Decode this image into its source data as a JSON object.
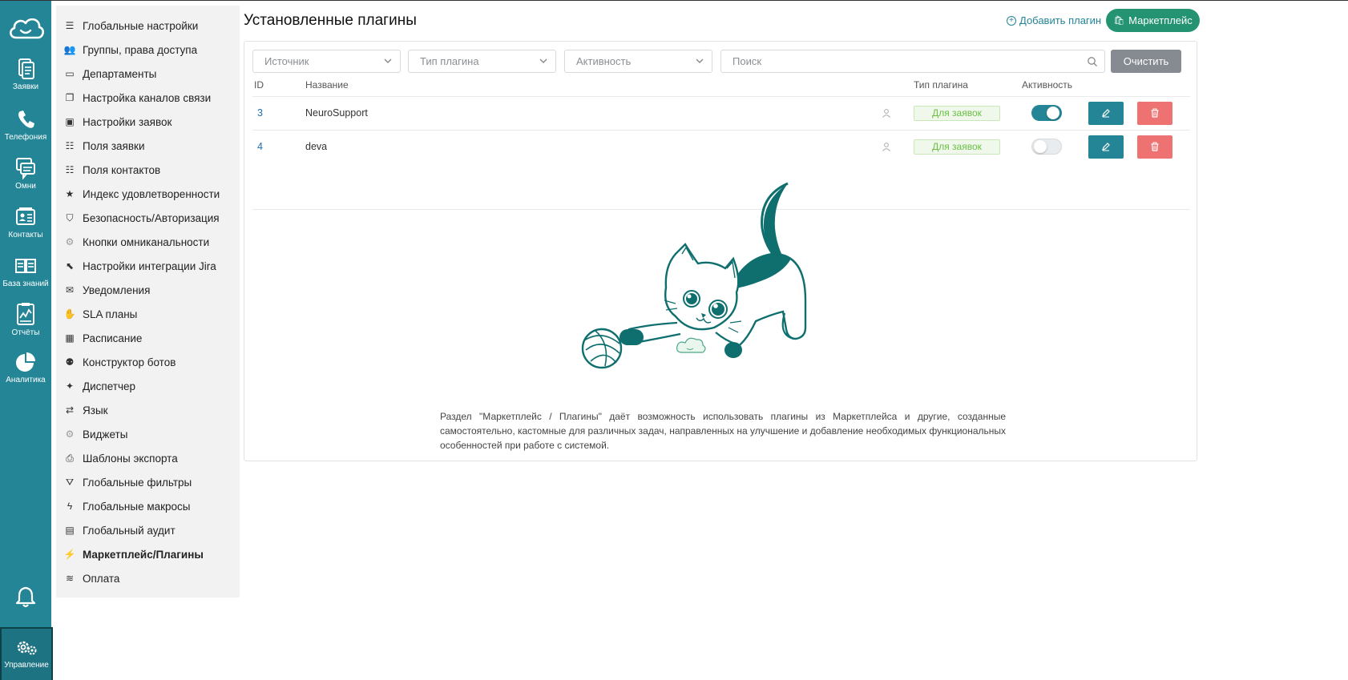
{
  "rail": {
    "items": [
      {
        "label": "Заявки",
        "icon": "requests-icon"
      },
      {
        "label": "Телефония",
        "icon": "phone-icon"
      },
      {
        "label": "Омни",
        "icon": "omni-chat-icon"
      },
      {
        "label": "Контакты",
        "icon": "contacts-icon"
      },
      {
        "label": "База знаний",
        "icon": "knowledge-base-icon"
      },
      {
        "label": "Отчёты",
        "icon": "reports-icon"
      },
      {
        "label": "Аналитика",
        "icon": "analytics-pie-icon"
      }
    ],
    "manage": {
      "label": "Управление",
      "icon": "gears-icon"
    }
  },
  "menu": {
    "items": [
      {
        "label": "Глобальные настройки",
        "icon": "sliders-icon"
      },
      {
        "label": "Группы, права доступа",
        "icon": "users-icon"
      },
      {
        "label": "Департаменты",
        "icon": "inbox-icon"
      },
      {
        "label": "Настройка каналов связи",
        "icon": "documents-icon"
      },
      {
        "label": "Настройки заявок",
        "icon": "image-icon"
      },
      {
        "label": "Поля заявки",
        "icon": "form-icon"
      },
      {
        "label": "Поля контактов",
        "icon": "form-edit-icon"
      },
      {
        "label": "Индекс удовлетворенности",
        "icon": "star-icon"
      },
      {
        "label": "Безопасность/Авторизация",
        "icon": "shield-icon"
      },
      {
        "label": "Кнопки омниканальности",
        "icon": "cog-icon"
      },
      {
        "label": "Настройки интеграции Jira",
        "icon": "jira-icon"
      },
      {
        "label": "Уведомления",
        "icon": "envelope-icon"
      },
      {
        "label": "SLA планы",
        "icon": "handshake-icon"
      },
      {
        "label": "Расписание",
        "icon": "calendar-icon"
      },
      {
        "label": "Конструктор ботов",
        "icon": "bot-icon"
      },
      {
        "label": "Диспетчер",
        "icon": "magic-wand-icon"
      },
      {
        "label": "Язык",
        "icon": "language-icon"
      },
      {
        "label": "Виджеты",
        "icon": "cog-icon"
      },
      {
        "label": "Шаблоны экспорта",
        "icon": "printer-icon"
      },
      {
        "label": "Глобальные фильтры",
        "icon": "filter-icon"
      },
      {
        "label": "Глобальные макросы",
        "icon": "bolt-icon"
      },
      {
        "label": "Глобальный аудит",
        "icon": "audit-icon"
      },
      {
        "label": "Маркетплейс/Плагины",
        "icon": "plug-icon",
        "active": true
      },
      {
        "label": "Оплата",
        "icon": "money-icon"
      }
    ]
  },
  "header": {
    "title": "Установленные плагины",
    "add_plugin": "Добавить плагин",
    "marketplace": "Маркетплейс"
  },
  "filters": {
    "source": "Источник",
    "plugin_type": "Тип плагина",
    "activity": "Активность",
    "search_placeholder": "Поиск",
    "clear": "Очистить"
  },
  "table": {
    "columns": [
      "ID",
      "Название",
      "Тип плагина",
      "Активность"
    ],
    "rows": [
      {
        "id": "3",
        "name": "NeuroSupport",
        "type": "Для заявок",
        "active": true
      },
      {
        "id": "4",
        "name": "deva",
        "type": "Для заявок",
        "active": false
      }
    ]
  },
  "description": "Раздел \"Маркетплейс / Плагины\" даёт возможность использовать плагины из Маркетплейса и другие, созданные самостоятельно, кастомные для различных задач, направленных на улучшение и добавление необходимых функциональных особенностей при работе с системой.",
  "colors": {
    "rail": "#238595",
    "accent": "#238595",
    "marketplace": "#239371",
    "delete": "#ee7272",
    "clear": "#868b91"
  }
}
